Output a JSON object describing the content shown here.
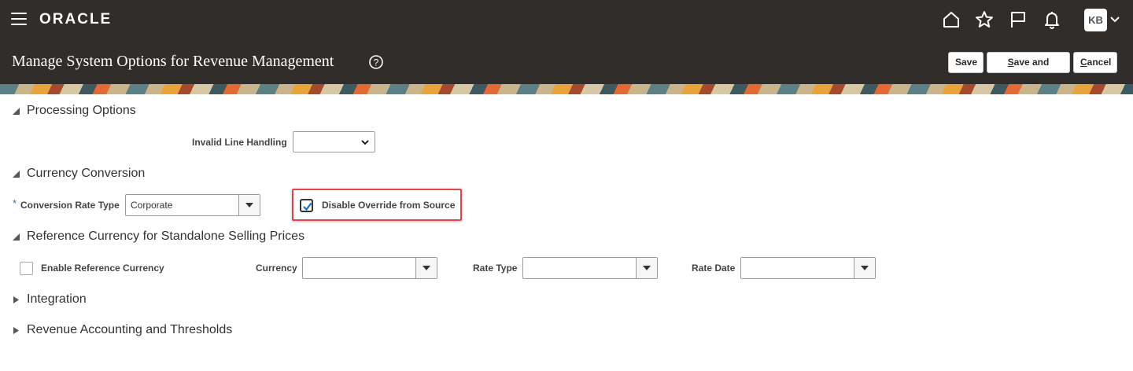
{
  "header": {
    "brand": "ORACLE",
    "avatar_initials": "KB",
    "icons": [
      "menu-icon",
      "home-icon",
      "star-icon",
      "flag-icon",
      "bell-icon",
      "chevron-down-icon"
    ]
  },
  "titlebar": {
    "title": "Manage System Options for Revenue Management",
    "buttons": {
      "save": "Save",
      "save_and_close_first": "S",
      "save_and_close_rest": "ave and Close",
      "cancel_first": "C",
      "cancel_rest": "ancel"
    }
  },
  "sections": {
    "processing": {
      "title": "Processing Options",
      "invalid_line_label": "Invalid Line Handling",
      "invalid_line_value": ""
    },
    "currency_conversion": {
      "title": "Currency Conversion",
      "required_marker": "*",
      "rate_type_label": "Conversion Rate Type",
      "rate_type_value": "Corporate",
      "disable_override_label": "Disable Override from Source",
      "disable_override_checked": true
    },
    "reference_currency": {
      "title": "Reference Currency for Standalone Selling Prices",
      "enable_label": "Enable Reference Currency",
      "enable_checked": false,
      "currency_label": "Currency",
      "currency_value": "",
      "rate_type_label": "Rate Type",
      "rate_type_value": "",
      "rate_date_label": "Rate Date",
      "rate_date_value": ""
    },
    "integration": {
      "title": "Integration"
    },
    "revenue_accounting": {
      "title": "Revenue Accounting and Thresholds"
    }
  },
  "colors": {
    "header_bg": "#312d2a",
    "highlight_border": "#e04848",
    "required_marker": "#3a6fb0",
    "check_mark": "#1f6fb5"
  }
}
